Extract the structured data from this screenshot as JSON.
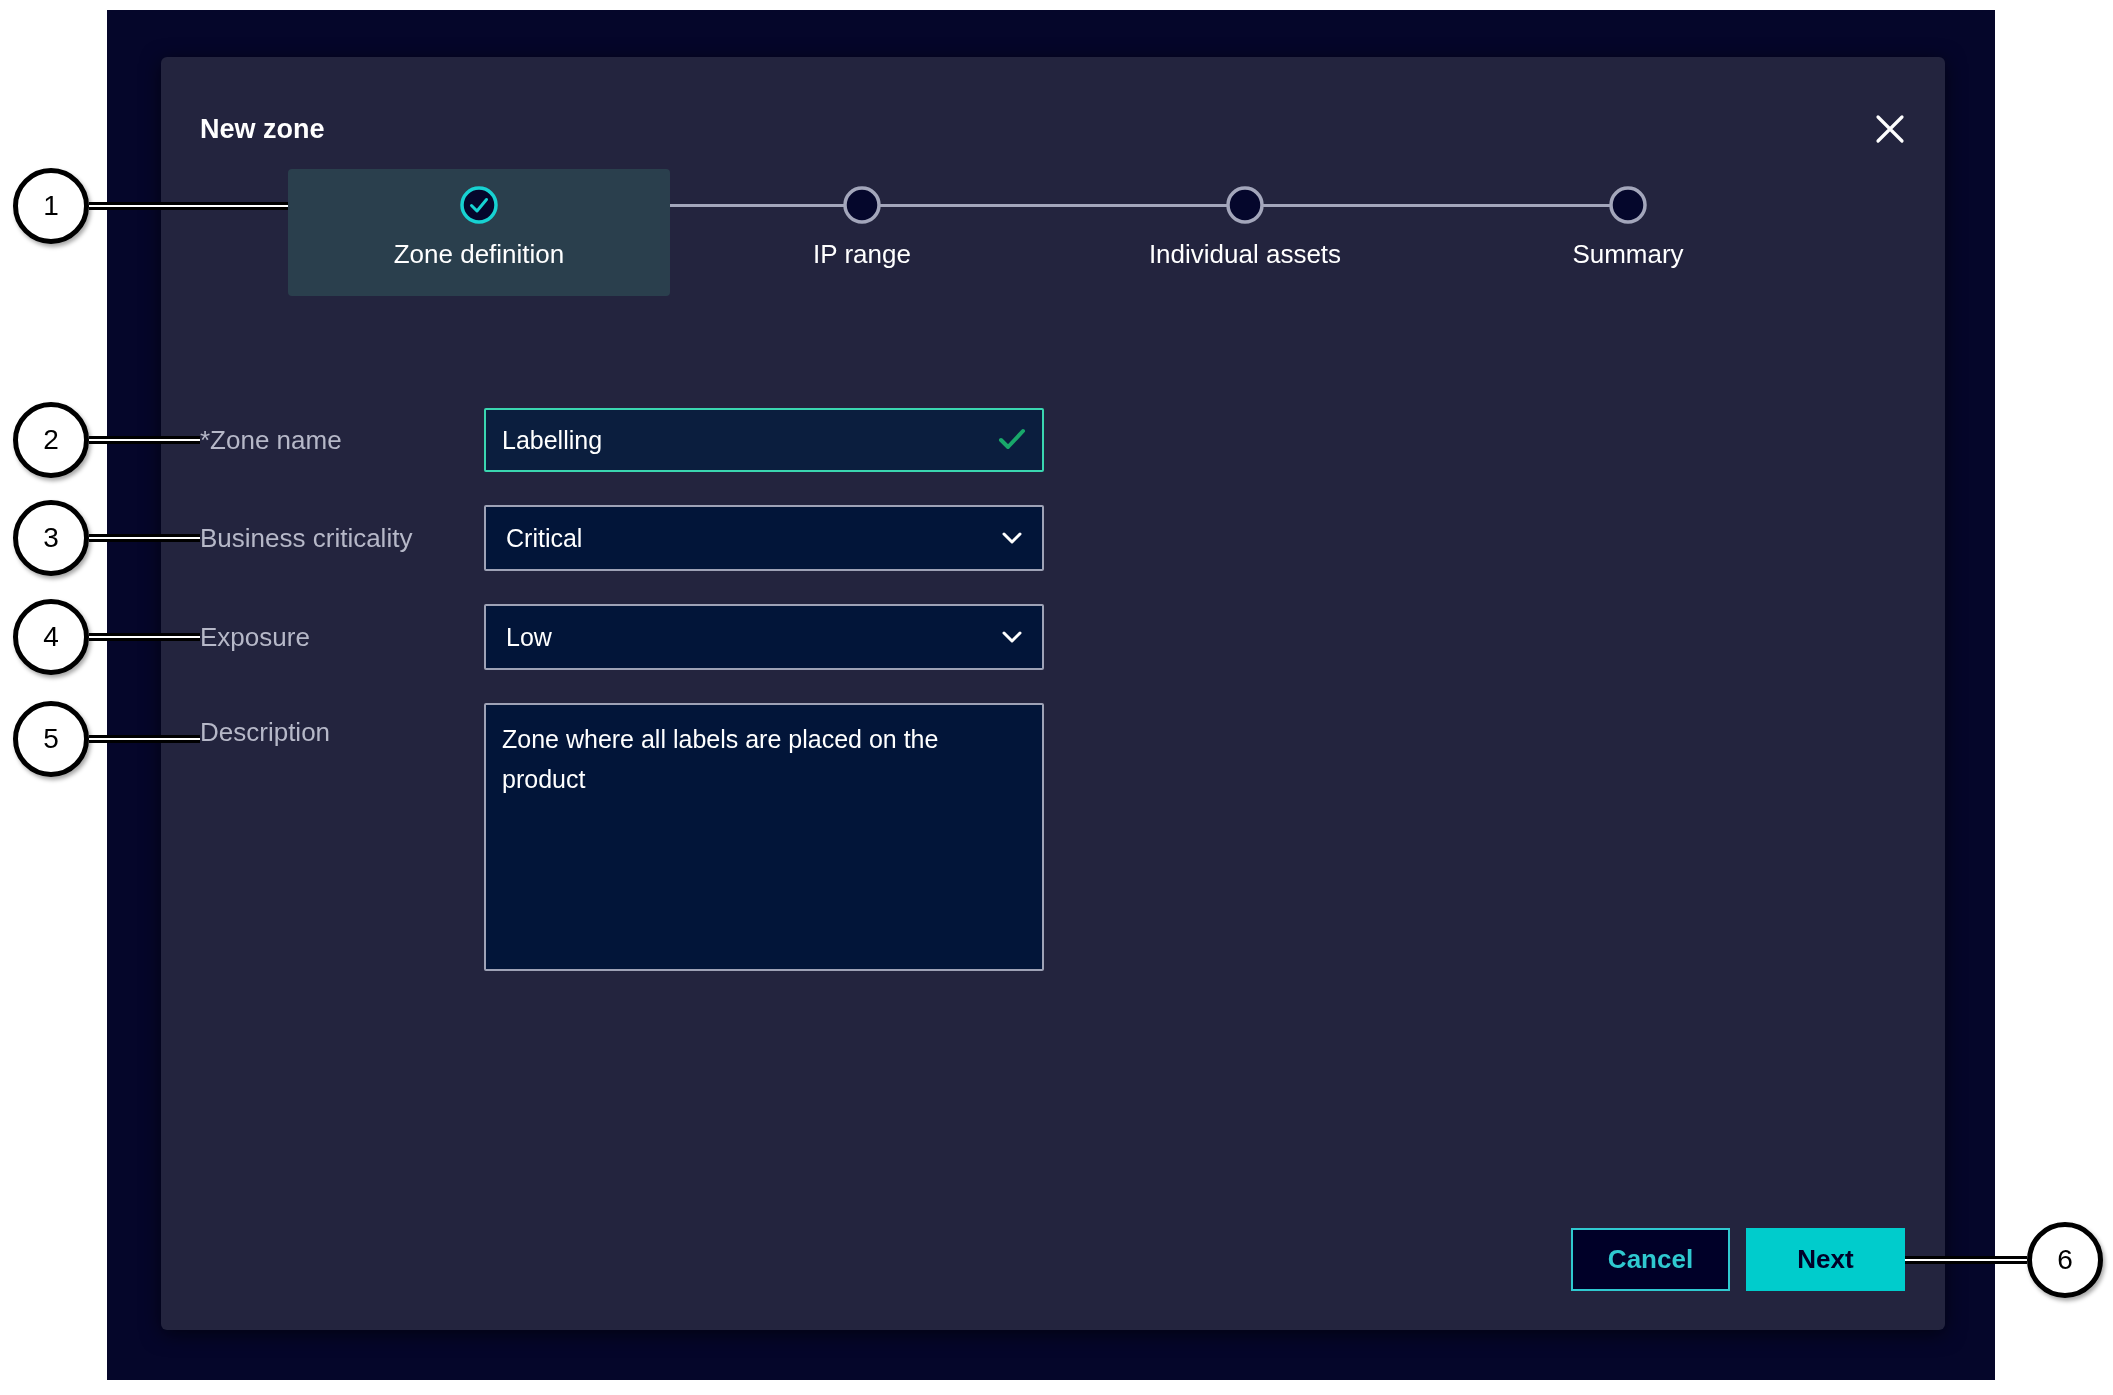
{
  "dialog": {
    "title": "New zone",
    "steps": [
      {
        "label": "Zone definition",
        "selected": true,
        "completed": true,
        "callout": "1"
      },
      {
        "label": "IP range",
        "selected": false,
        "completed": false
      },
      {
        "label": "Individual assets",
        "selected": false,
        "completed": false
      },
      {
        "label": "Summary",
        "selected": false,
        "completed": false
      }
    ],
    "fields": [
      {
        "kind": "text",
        "label": "*Zone name",
        "value": "Labelling",
        "valid": true,
        "callout": "2"
      },
      {
        "kind": "select",
        "label": "Business criticality",
        "value": "Critical",
        "callout": "3"
      },
      {
        "kind": "select",
        "label": "Exposure",
        "value": "Low",
        "callout": "4"
      },
      {
        "kind": "textarea",
        "label": "Description",
        "value": "Zone where all labels are placed on the product",
        "callout": "5"
      }
    ],
    "buttons": [
      {
        "label": "Cancel",
        "kind": "secondary"
      },
      {
        "label": "Next",
        "kind": "primary",
        "callout": "6"
      }
    ]
  }
}
